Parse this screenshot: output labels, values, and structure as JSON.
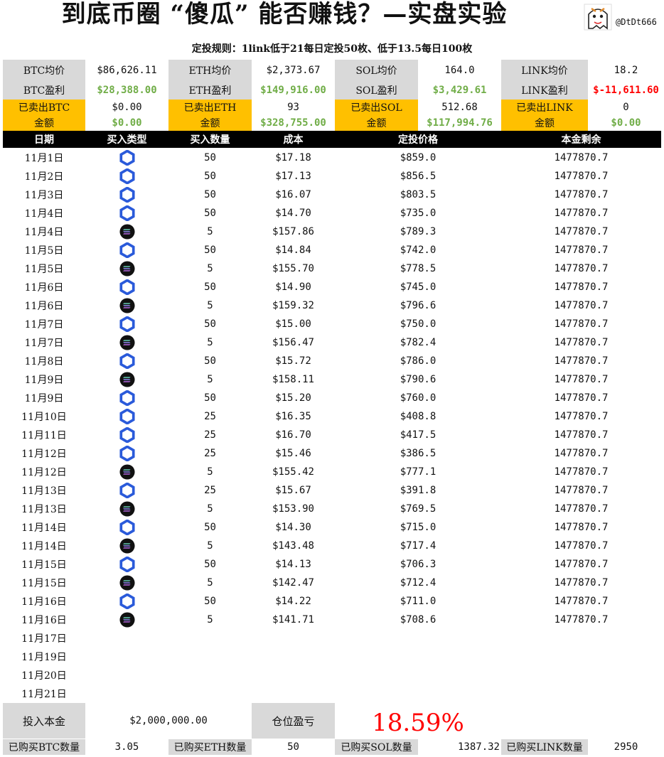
{
  "header": {
    "title": "到底币圈 “傻瓜” 能否赚钱？—实盘实验",
    "handle": "@DtDt666",
    "rule": "定投规则：1link低于21每日定投50枚、低于13.5每日100枚"
  },
  "summary": {
    "btc_avg_label": "BTC均价",
    "btc_avg": "$86,626.11",
    "eth_avg_label": "ETH均价",
    "eth_avg": "$2,373.67",
    "sol_avg_label": "SOL均价",
    "sol_avg": "164.0",
    "link_avg_label": "LINK均价",
    "link_avg": "18.2",
    "btc_pnl_label": "BTC盈利",
    "btc_pnl": "$28,388.00",
    "eth_pnl_label": "ETH盈利",
    "eth_pnl": "$149,916.00",
    "sol_pnl_label": "SOL盈利",
    "sol_pnl": "$3,429.61",
    "link_pnl_label": "LINK盈利",
    "link_pnl": "$-11,611.60",
    "btc_sold_label": "已卖出BTC",
    "btc_sold": "$0.00",
    "eth_sold_label": "已卖出ETH",
    "eth_sold": "93",
    "sol_sold_label": "已卖出SOL",
    "sol_sold": "512.68",
    "link_sold_label": "已卖出LINK",
    "link_sold": "0",
    "amount_label": "金额",
    "btc_amount": "$0.00",
    "eth_amount": "$328,755.00",
    "sol_amount": "$117,994.76",
    "link_amount": "$0.00"
  },
  "table": {
    "columns": [
      "日期",
      "买入类型",
      "买入数量",
      "成本",
      "定投价格",
      "本金剩余"
    ],
    "rows": [
      {
        "date": "11月1日",
        "type": "link",
        "qty": "50",
        "cost": "$17.18",
        "price": "$859.0",
        "remain": "1477870.7"
      },
      {
        "date": "11月2日",
        "type": "link",
        "qty": "50",
        "cost": "$17.13",
        "price": "$856.5",
        "remain": "1477870.7"
      },
      {
        "date": "11月3日",
        "type": "link",
        "qty": "50",
        "cost": "$16.07",
        "price": "$803.5",
        "remain": "1477870.7"
      },
      {
        "date": "11月4日",
        "type": "link",
        "qty": "50",
        "cost": "$14.70",
        "price": "$735.0",
        "remain": "1477870.7"
      },
      {
        "date": "11月4日",
        "type": "sol",
        "qty": "5",
        "cost": "$157.86",
        "price": "$789.3",
        "remain": "1477870.7"
      },
      {
        "date": "11月5日",
        "type": "link",
        "qty": "50",
        "cost": "$14.84",
        "price": "$742.0",
        "remain": "1477870.7"
      },
      {
        "date": "11月5日",
        "type": "sol",
        "qty": "5",
        "cost": "$155.70",
        "price": "$778.5",
        "remain": "1477870.7"
      },
      {
        "date": "11月6日",
        "type": "link",
        "qty": "50",
        "cost": "$14.90",
        "price": "$745.0",
        "remain": "1477870.7"
      },
      {
        "date": "11月6日",
        "type": "sol",
        "qty": "5",
        "cost": "$159.32",
        "price": "$796.6",
        "remain": "1477870.7"
      },
      {
        "date": "11月7日",
        "type": "link",
        "qty": "50",
        "cost": "$15.00",
        "price": "$750.0",
        "remain": "1477870.7"
      },
      {
        "date": "11月7日",
        "type": "sol",
        "qty": "5",
        "cost": "$156.47",
        "price": "$782.4",
        "remain": "1477870.7"
      },
      {
        "date": "11月8日",
        "type": "link",
        "qty": "50",
        "cost": "$15.72",
        "price": "$786.0",
        "remain": "1477870.7"
      },
      {
        "date": "11月9日",
        "type": "sol",
        "qty": "5",
        "cost": "$158.11",
        "price": "$790.6",
        "remain": "1477870.7"
      },
      {
        "date": "11月9日",
        "type": "link",
        "qty": "50",
        "cost": "$15.20",
        "price": "$760.0",
        "remain": "1477870.7"
      },
      {
        "date": "11月10日",
        "type": "link",
        "qty": "25",
        "cost": "$16.35",
        "price": "$408.8",
        "remain": "1477870.7"
      },
      {
        "date": "11月11日",
        "type": "link",
        "qty": "25",
        "cost": "$16.70",
        "price": "$417.5",
        "remain": "1477870.7"
      },
      {
        "date": "11月12日",
        "type": "link",
        "qty": "25",
        "cost": "$15.46",
        "price": "$386.5",
        "remain": "1477870.7"
      },
      {
        "date": "11月12日",
        "type": "sol",
        "qty": "5",
        "cost": "$155.42",
        "price": "$777.1",
        "remain": "1477870.7"
      },
      {
        "date": "11月13日",
        "type": "link",
        "qty": "25",
        "cost": "$15.67",
        "price": "$391.8",
        "remain": "1477870.7"
      },
      {
        "date": "11月13日",
        "type": "sol",
        "qty": "5",
        "cost": "$153.90",
        "price": "$769.5",
        "remain": "1477870.7"
      },
      {
        "date": "11月14日",
        "type": "link",
        "qty": "50",
        "cost": "$14.30",
        "price": "$715.0",
        "remain": "1477870.7"
      },
      {
        "date": "11月14日",
        "type": "sol",
        "qty": "5",
        "cost": "$143.48",
        "price": "$717.4",
        "remain": "1477870.7"
      },
      {
        "date": "11月15日",
        "type": "link",
        "qty": "50",
        "cost": "$14.13",
        "price": "$706.3",
        "remain": "1477870.7"
      },
      {
        "date": "11月15日",
        "type": "sol",
        "qty": "5",
        "cost": "$142.47",
        "price": "$712.4",
        "remain": "1477870.7"
      },
      {
        "date": "11月16日",
        "type": "link",
        "qty": "50",
        "cost": "$14.22",
        "price": "$711.0",
        "remain": "1477870.7"
      },
      {
        "date": "11月16日",
        "type": "sol",
        "qty": "5",
        "cost": "$141.71",
        "price": "$708.6",
        "remain": "1477870.7"
      },
      {
        "date": "11月17日",
        "type": "",
        "qty": "",
        "cost": "",
        "price": "",
        "remain": ""
      },
      {
        "date": "11月19日",
        "type": "",
        "qty": "",
        "cost": "",
        "price": "",
        "remain": ""
      },
      {
        "date": "11月20日",
        "type": "",
        "qty": "",
        "cost": "",
        "price": "",
        "remain": ""
      },
      {
        "date": "11月21日",
        "type": "",
        "qty": "",
        "cost": "",
        "price": "",
        "remain": ""
      }
    ]
  },
  "footer": {
    "principal_label": "投入本金",
    "principal": "$2,000,000.00",
    "position_label": "仓位盈亏",
    "position_pct": "18.59%",
    "btc_qty_label": "已购买BTC数量",
    "btc_qty": "3.05",
    "eth_qty_label": "已购买ETH数量",
    "eth_qty": "50",
    "sol_qty_label": "已购买SOL数量",
    "sol_qty": "1387.32",
    "link_qty_label": "已购买LINK数量",
    "link_qty": "2950"
  },
  "icons": {
    "link": "chainlink-icon",
    "sol": "solana-icon"
  },
  "colors": {
    "gray": "#d9d9d9",
    "orange": "#ffc000",
    "green": "#70ad47",
    "red": "#ff0000",
    "link_blue": "#2a5ada"
  }
}
